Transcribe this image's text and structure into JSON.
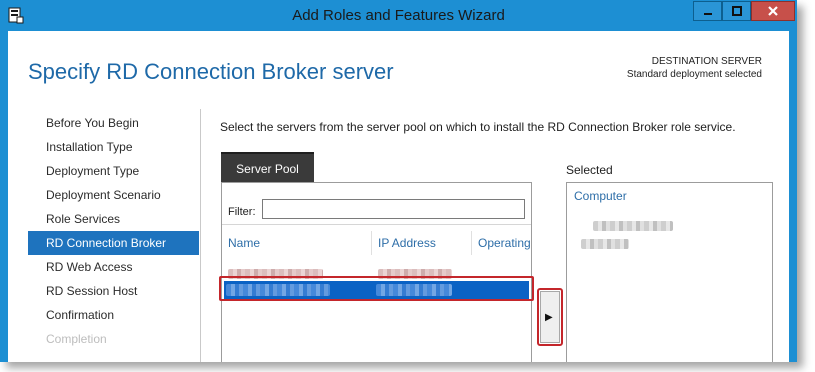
{
  "window": {
    "title": "Add Roles and Features Wizard",
    "controls": {
      "minimize_icon": "minimize-icon",
      "maximize_icon": "maximize-icon",
      "close_icon": "close-icon"
    }
  },
  "header": {
    "page_title": "Specify RD Connection Broker server",
    "destination_label": "DESTINATION SERVER",
    "destination_value": "Standard deployment selected"
  },
  "nav": {
    "items": [
      {
        "label": "Before You Begin",
        "state": "normal"
      },
      {
        "label": "Installation Type",
        "state": "normal"
      },
      {
        "label": "Deployment Type",
        "state": "normal"
      },
      {
        "label": "Deployment Scenario",
        "state": "normal"
      },
      {
        "label": "Role Services",
        "state": "normal"
      },
      {
        "label": "RD Connection Broker",
        "state": "active"
      },
      {
        "label": "RD Web Access",
        "state": "normal"
      },
      {
        "label": "RD Session Host",
        "state": "normal"
      },
      {
        "label": "Confirmation",
        "state": "normal"
      },
      {
        "label": "Completion",
        "state": "disabled"
      }
    ]
  },
  "main": {
    "instruction": "Select the servers from the server pool on which to install the RD Connection Broker role service.",
    "server_pool": {
      "tab_label": "Server Pool",
      "filter_label": "Filter:",
      "filter_value": "",
      "columns": [
        "Name",
        "IP Address",
        "Operating"
      ]
    },
    "add_button_symbol": "▶",
    "selected": {
      "label": "Selected",
      "column": "Computer"
    }
  },
  "colors": {
    "accent": "#1e73be",
    "window_frame": "#1d8fd3",
    "title_text": "#1e69a8",
    "highlight_red": "#c4262b"
  }
}
